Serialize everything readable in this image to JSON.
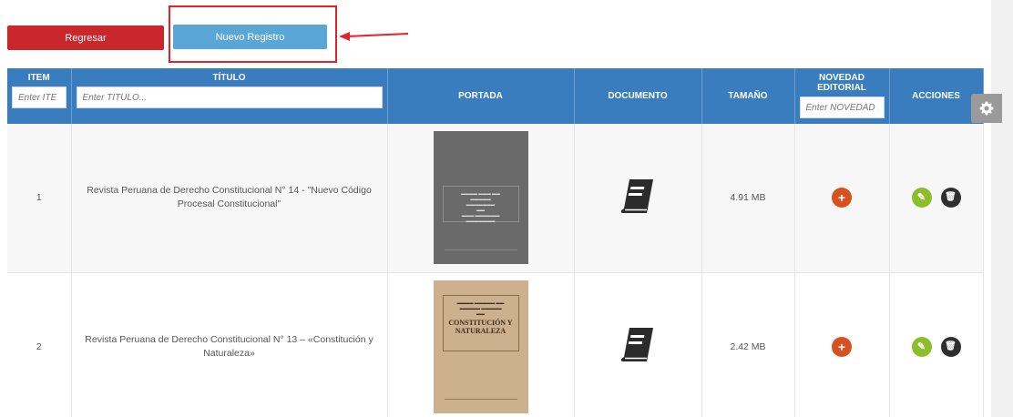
{
  "buttons": {
    "back": "Regresar",
    "new": "Nuevo Registro"
  },
  "table": {
    "headers": {
      "item": "ITEM",
      "titulo": "TÍTULO",
      "portada": "PORTADA",
      "documento": "DOCUMENTO",
      "tamano": "TAMAÑO",
      "novedad": "NOVEDAD EDITORIAL",
      "acciones": "ACCIONES"
    },
    "filters": {
      "item": "Enter ITE",
      "titulo": "Enter TÍTULO...",
      "novedad": "Enter NOVEDAD I"
    },
    "rows": [
      {
        "item": "1",
        "title": "Revista Peruana de Derecho Constitucional N° 14 - \"Nuevo Código Procesal Constitucional\"",
        "size": "4.91 MB"
      },
      {
        "item": "2",
        "title": "Revista Peruana de Derecho Constitucional N° 13 – «Constitución y Naturaleza»",
        "size": "2.42 MB",
        "cover_heading": "CONSTITUCIÓN Y NATURALEZA"
      }
    ]
  },
  "colors": {
    "header": "#3a7dbf",
    "back": "#c9272b",
    "new": "#5aa6d6",
    "highlight": "#e3232b"
  },
  "icons": [
    "document-book-icon",
    "add-icon",
    "edit-icon",
    "delete-icon",
    "gear-icon"
  ]
}
